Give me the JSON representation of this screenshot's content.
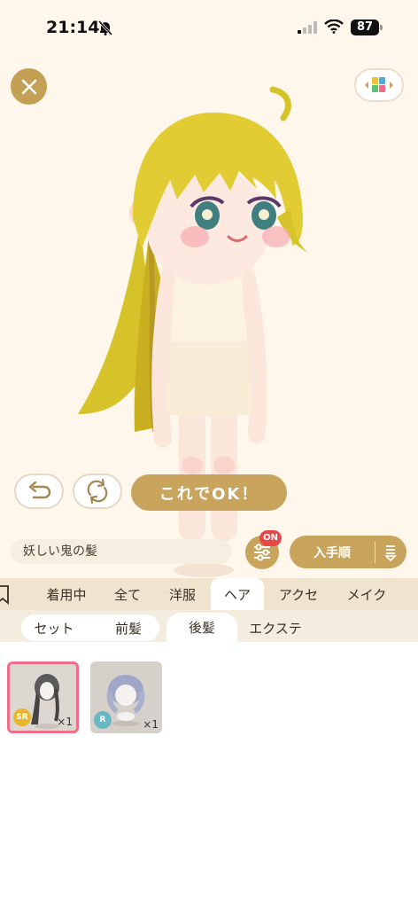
{
  "status": {
    "time": "21:14",
    "battery": "87"
  },
  "actions": {
    "ok_label": "これでOK！"
  },
  "item_name": "妖しい鬼の髪",
  "filter": {
    "badge": "ON"
  },
  "sort": {
    "label": "入手順"
  },
  "categories": [
    "着用中",
    "全て",
    "洋服",
    "ヘア",
    "アクセ",
    "メイク"
  ],
  "active_category": "ヘア",
  "sub_tabs": [
    "セット",
    "前髪",
    "後髪",
    "エクステ"
  ],
  "active_sub_tab": "後髪",
  "items": [
    {
      "rarity": "SR",
      "count": "×1",
      "rarity_color": "#e9b52c"
    },
    {
      "rarity": "R",
      "count": "×1",
      "rarity_color": "#6ab6c2"
    }
  ],
  "colors": {
    "accent": "#c8a45c",
    "badge": "#e64848",
    "selected": "#ef6f8a"
  }
}
